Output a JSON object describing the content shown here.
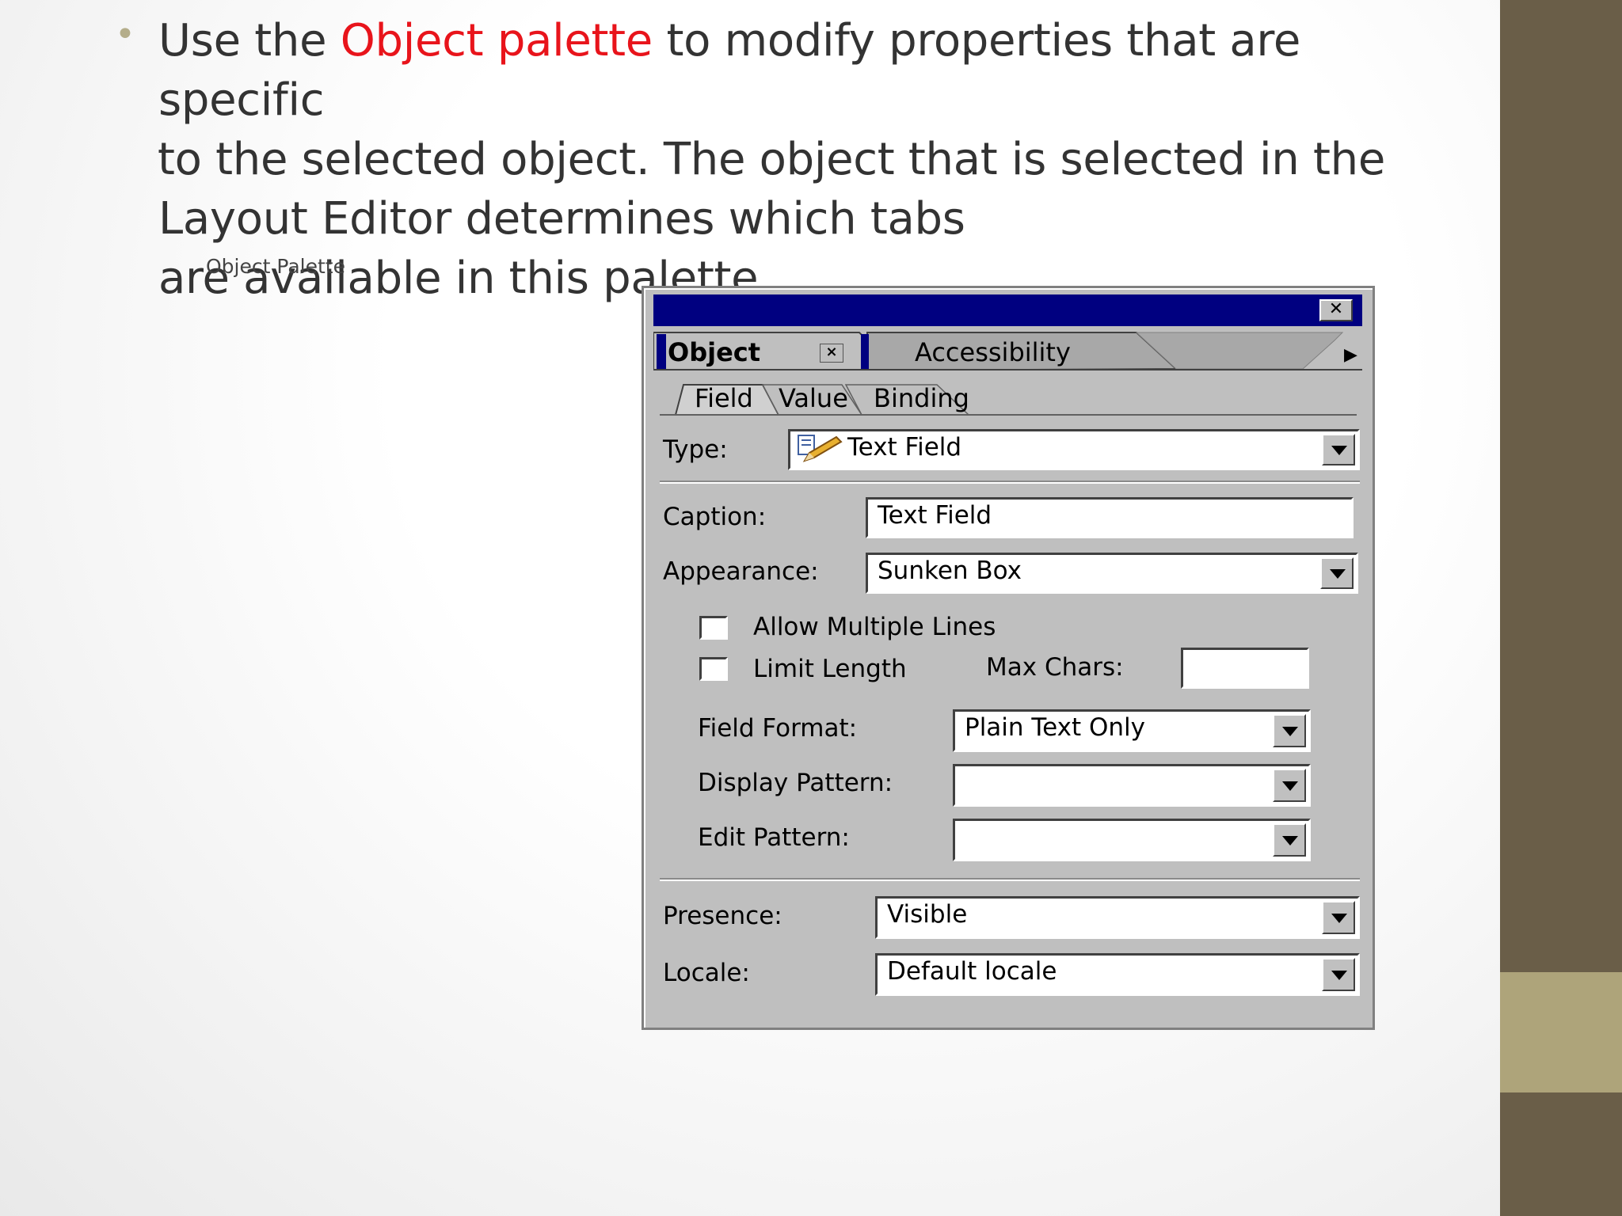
{
  "bullet": {
    "line1_pre": "Use the ",
    "line1_highlight": "Object palette",
    "line1_post": " to modify properties that are specific",
    "line2": "to the selected object. The object that is selected in the",
    "line3": "Layout Editor determines which tabs",
    "line4": " are available in this palette."
  },
  "image_caption": "Object Palette",
  "palette": {
    "close_label": "✕",
    "tabs": {
      "object": "Object",
      "object_close": "×",
      "accessibility": "Accessibility",
      "more": "▶"
    },
    "subtabs": {
      "field": "Field",
      "value": "Value",
      "binding": "Binding"
    },
    "type": {
      "label": "Type:",
      "value": "Text Field"
    },
    "caption": {
      "label": "Caption:",
      "value": "Text Field"
    },
    "appearance": {
      "label": "Appearance:",
      "value": "Sunken Box"
    },
    "allow_multiple_lines": {
      "label": "Allow Multiple Lines",
      "checked": false
    },
    "limit_length": {
      "label": "Limit Length",
      "checked": false
    },
    "max_chars": {
      "label": "Max Chars:",
      "value": ""
    },
    "field_format": {
      "label": "Field Format:",
      "value": "Plain Text Only"
    },
    "display_pattern": {
      "label": "Display Pattern:",
      "value": ""
    },
    "edit_pattern": {
      "label": "Edit Pattern:",
      "value": ""
    },
    "presence": {
      "label": "Presence:",
      "value": "Visible"
    },
    "locale": {
      "label": "Locale:",
      "value": "Default locale"
    }
  },
  "colors": {
    "highlight": "#e8141b",
    "titlebar": "#000080",
    "sidebar": "#6a5e48",
    "sidebar_accent": "#aea47a"
  }
}
